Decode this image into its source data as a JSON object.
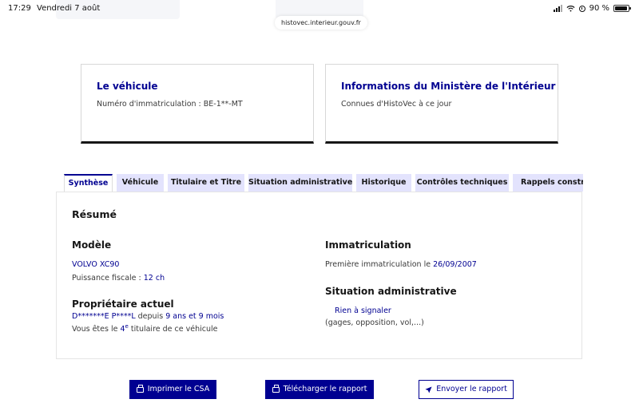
{
  "status_bar": {
    "time": "17:29",
    "date": "Vendredi 7 août",
    "battery": "90 %"
  },
  "browser": {
    "url": "histovec.interieur.gouv.fr"
  },
  "cards": {
    "vehicle": {
      "title": "Le véhicule",
      "subtitle": "Numéro d'immatriculation : BE-1**-MT"
    },
    "ministry": {
      "title": "Informations du Ministère de l'Intérieur",
      "subtitle": "Connues d'HistoVec à ce jour"
    }
  },
  "tabs": [
    {
      "label": "Synthèse",
      "active": true
    },
    {
      "label": "Véhicule",
      "active": false
    },
    {
      "label": "Titulaire et Titre",
      "active": false
    },
    {
      "label": "Situation administrative",
      "active": false
    },
    {
      "label": "Historique",
      "active": false
    },
    {
      "label": "Contrôles techniques",
      "active": false
    },
    {
      "label": "Rappels constructeur",
      "active": false
    }
  ],
  "summary": {
    "heading": "Résumé",
    "model": {
      "heading": "Modèle",
      "name": "VOLVO XC90",
      "power_label": "Puissance fiscale :",
      "power_value": "12 ch"
    },
    "owner": {
      "heading": "Propriétaire actuel",
      "name": "D*******E P****L",
      "since_label": "depuis",
      "duration": "9 ans et 9 mois",
      "rank_prefix": "Vous êtes le",
      "rank_number": "4",
      "rank_sup": "e",
      "rank_suffix": "titulaire de ce véhicule"
    },
    "registration": {
      "heading": "Immatriculation",
      "first_label": "Première immatriculation le",
      "first_date": "26/09/2007"
    },
    "admin": {
      "heading": "Situation administrative",
      "status": "Rien à signaler",
      "details": "(gages, opposition, vol,...)"
    }
  },
  "actions": {
    "print": "Imprimer le CSA",
    "download": "Télécharger le rapport",
    "send": "Envoyer le rapport"
  },
  "colors": {
    "primary": "#000091",
    "tab_background": "#e3e3fd",
    "card_border_bottom": "#161616"
  }
}
